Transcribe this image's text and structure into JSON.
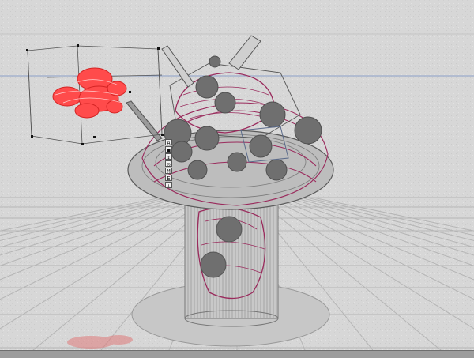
{
  "viewport": {
    "colors": {
      "background": "#d7d7d7",
      "grid": "#b9b9b9",
      "horizon_line": "#8ea2c8",
      "wire_grey": "#6b6b6b",
      "wire_magenta": "#9a2a5c",
      "sphere_grey": "#6f6f6f",
      "selected_object": "#ff3a3a",
      "bounding_box": "#444444"
    }
  },
  "selected_object": {
    "icon": "flower-mesh-icon"
  },
  "mini_toolbar": {
    "buttons": [
      {
        "icon": "text-a-icon",
        "glyph": "A"
      },
      {
        "icon": "square-icon",
        "glyph": "■"
      },
      {
        "icon": "move-icon",
        "glyph": "↕"
      },
      {
        "icon": "target-icon",
        "glyph": "◎"
      },
      {
        "icon": "mesh-m-icon",
        "glyph": "M"
      },
      {
        "icon": "edit-e-icon",
        "glyph": "E"
      },
      {
        "icon": "down-arrow-icon",
        "glyph": "↓"
      }
    ]
  }
}
